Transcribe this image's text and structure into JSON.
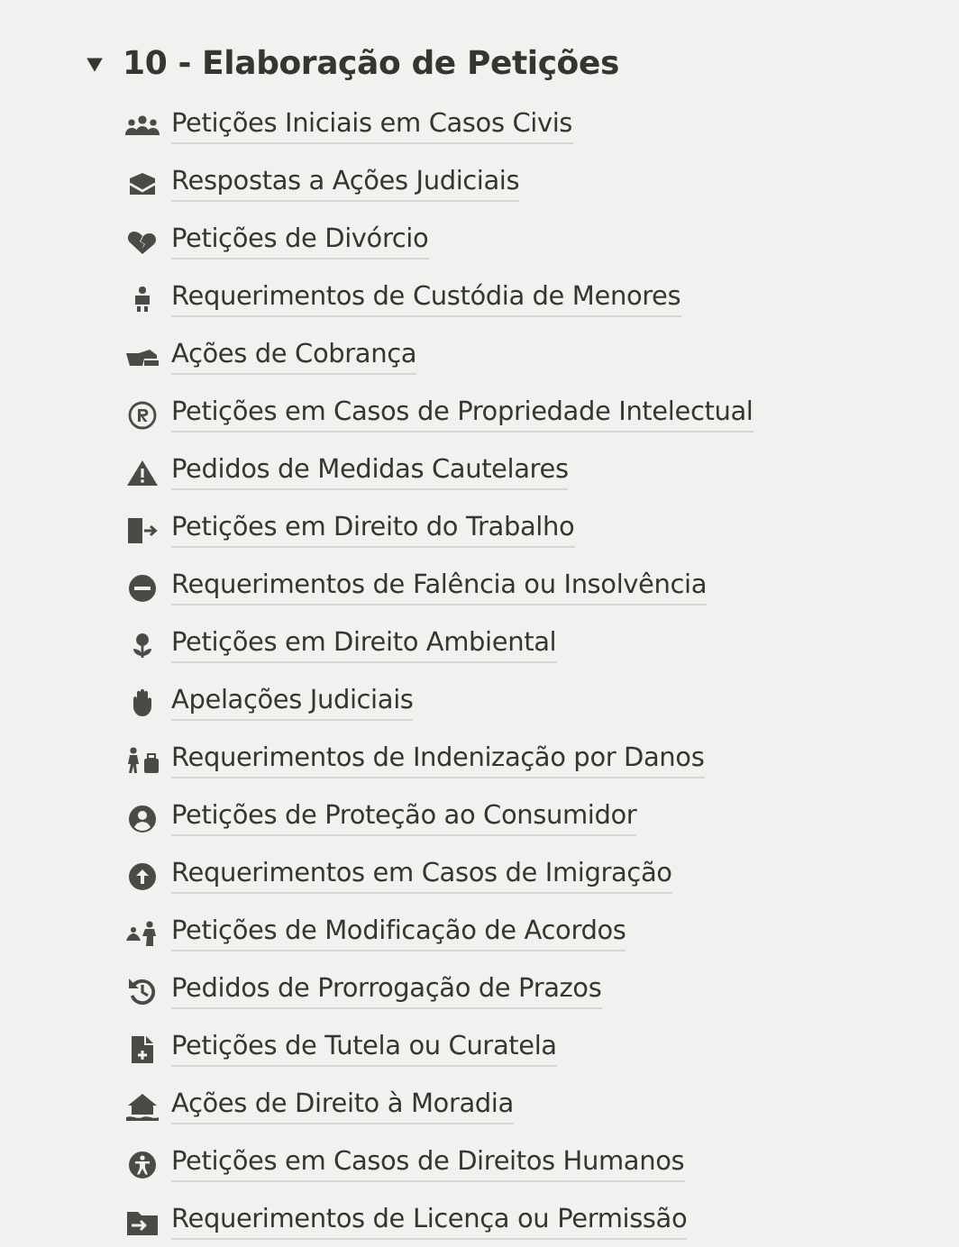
{
  "toggle": {
    "title": "10 - Elaboração de Petições",
    "expanded": true,
    "items": [
      {
        "label": "Petições Iniciais em Casos Civis"
      },
      {
        "label": "Respostas a Ações Judiciais"
      },
      {
        "label": "Petições de Divórcio"
      },
      {
        "label": "Requerimentos de Custódia de Menores"
      },
      {
        "label": "Ações de Cobrança"
      },
      {
        "label": "Petições em Casos de Propriedade Intelectual"
      },
      {
        "label": "Pedidos de Medidas Cautelares"
      },
      {
        "label": "Petições em Direito do Trabalho"
      },
      {
        "label": "Requerimentos de Falência ou Insolvência"
      },
      {
        "label": "Petições em Direito Ambiental"
      },
      {
        "label": "Apelações Judiciais"
      },
      {
        "label": "Requerimentos de Indenização por Danos"
      },
      {
        "label": "Petições de Proteção ao Consumidor"
      },
      {
        "label": "Requerimentos em Casos de Imigração"
      },
      {
        "label": "Petições de Modificação de Acordos"
      },
      {
        "label": "Pedidos de Prorrogação de Prazos"
      },
      {
        "label": "Petições de Tutela ou Curatela"
      },
      {
        "label": "Ações de Direito à Moradia"
      },
      {
        "label": "Petições em Casos de Direitos Humanos"
      },
      {
        "label": "Requerimentos de Licença ou Permissão"
      }
    ]
  }
}
